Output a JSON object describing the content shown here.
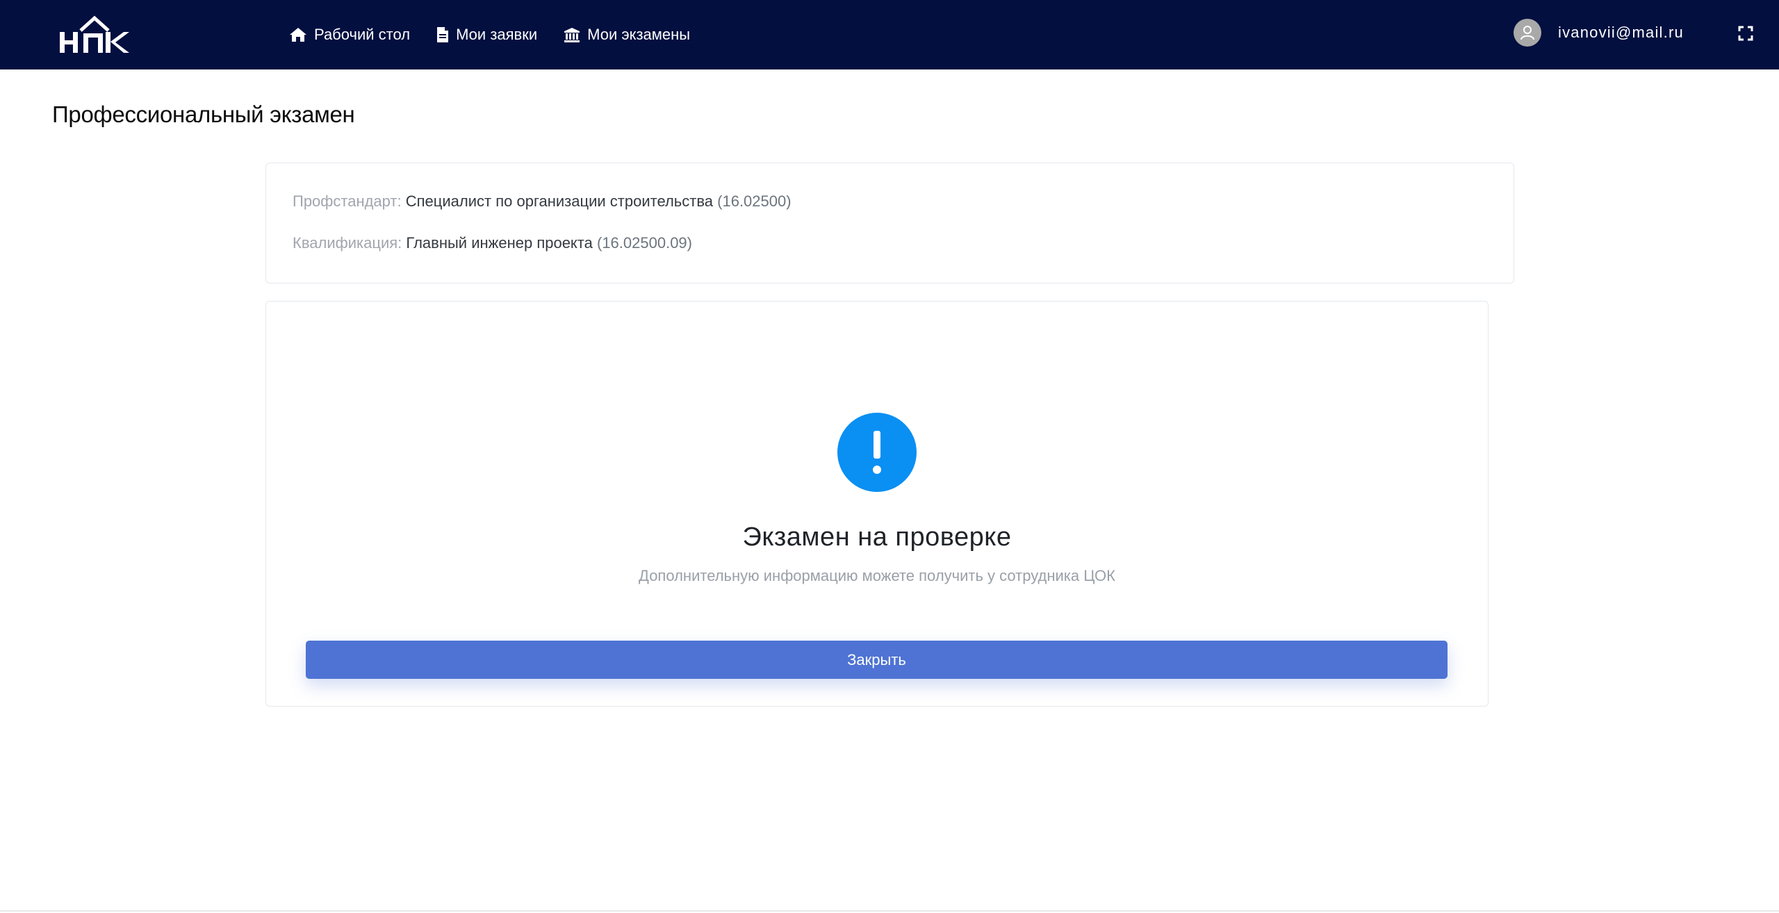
{
  "header": {
    "logo_text": "НПК",
    "nav": [
      {
        "label": "Рабочий стол",
        "icon": "home-icon"
      },
      {
        "label": "Мои заявки",
        "icon": "document-icon"
      },
      {
        "label": "Мои экзамены",
        "icon": "institution-icon"
      }
    ],
    "user_email": "ivanovii@mail.ru"
  },
  "page": {
    "title": "Профессиональный экзамен"
  },
  "info": {
    "standard_label": "Профстандарт:",
    "standard_value": "Специалист по организации строительства",
    "standard_code": "(16.02500)",
    "qualification_label": "Квалификация:",
    "qualification_value": "Главный инженер проекта",
    "qualification_code": "(16.02500.09)"
  },
  "status": {
    "icon": "exclamation-circle-icon",
    "title": "Экзамен на проверке",
    "subtitle": "Дополнительную информацию можете получить у сотрудника ЦОК",
    "close_label": "Закрыть"
  },
  "colors": {
    "header_bg": "#020f3f",
    "accent_blue": "#0a8ff3",
    "button_blue": "#4e73d4"
  }
}
